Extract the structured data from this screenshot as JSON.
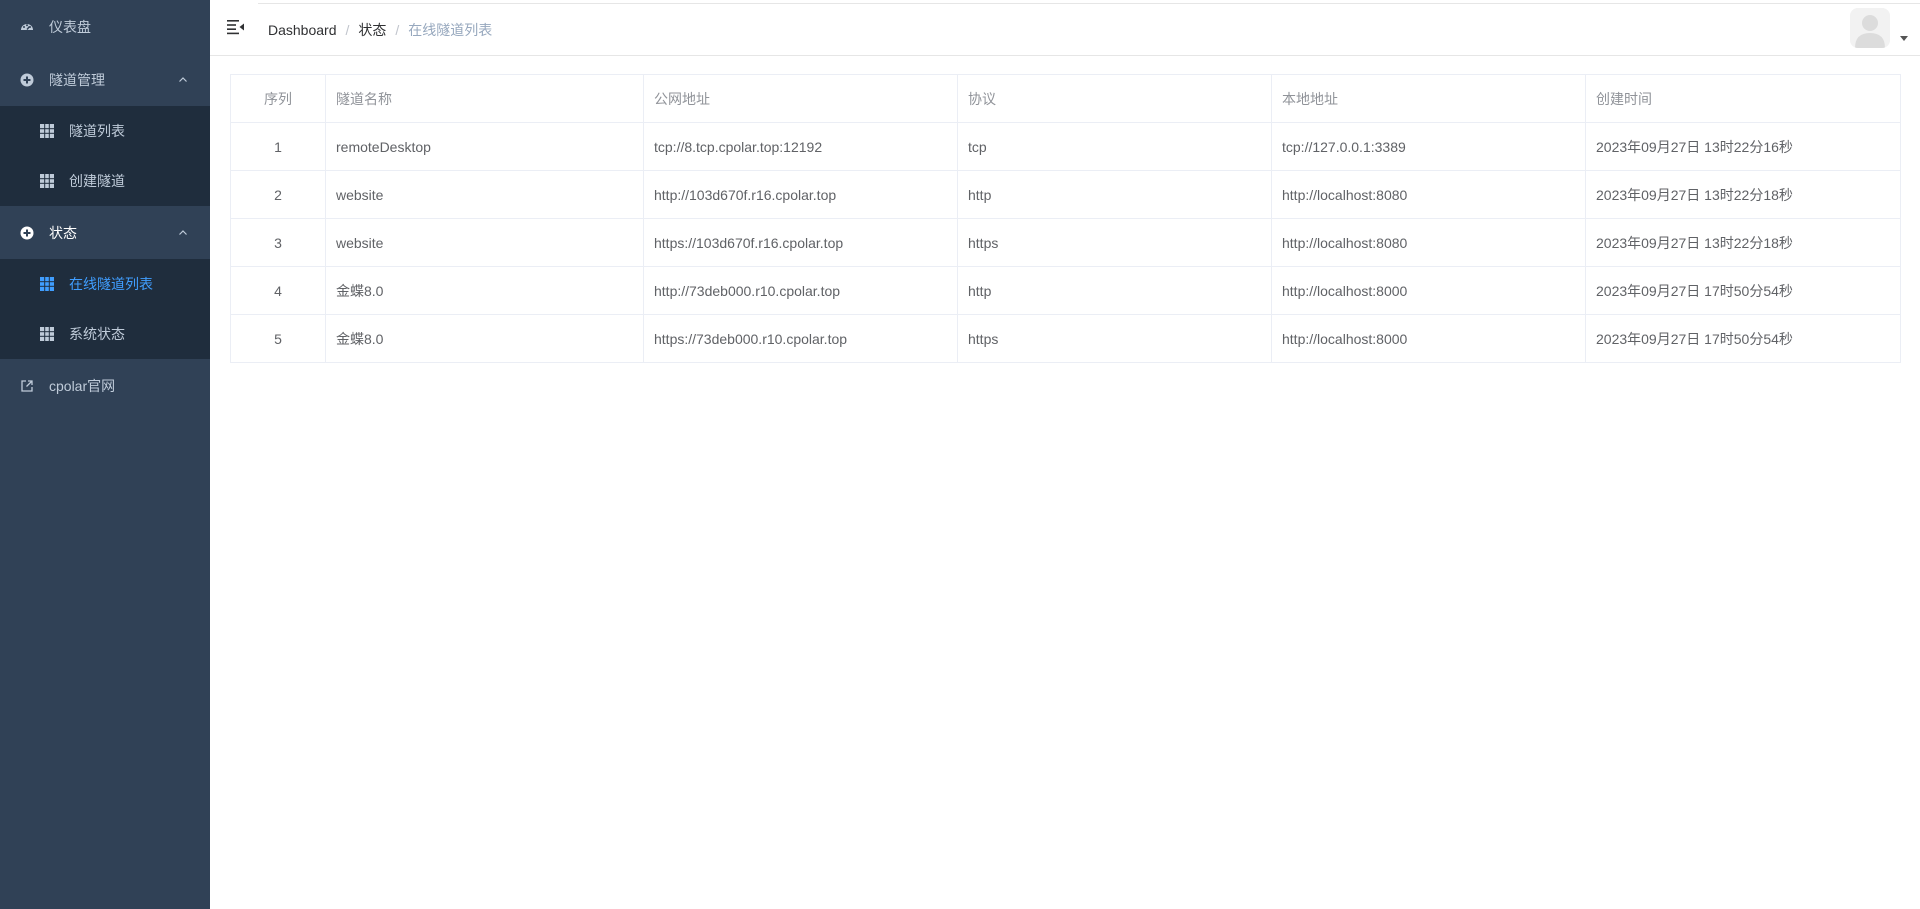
{
  "sidebar": {
    "items": [
      {
        "label": "仪表盘",
        "icon": "dashboard-icon"
      },
      {
        "label": "隧道管理",
        "icon": "plus-circle-icon",
        "expanded": true,
        "children": [
          {
            "label": "隧道列表",
            "icon": "grid-icon"
          },
          {
            "label": "创建隧道",
            "icon": "grid-icon"
          }
        ]
      },
      {
        "label": "状态",
        "icon": "plus-circle-icon",
        "expanded": true,
        "children": [
          {
            "label": "在线隧道列表",
            "icon": "grid-icon",
            "active": true
          },
          {
            "label": "系统状态",
            "icon": "grid-icon"
          }
        ]
      },
      {
        "label": "cpolar官网",
        "icon": "external-link-icon"
      }
    ]
  },
  "breadcrumb": {
    "items": [
      "Dashboard",
      "状态",
      "在线隧道列表"
    ]
  },
  "table": {
    "columns": [
      "序列",
      "隧道名称",
      "公网地址",
      "协议",
      "本地地址",
      "创建时间"
    ],
    "rows": [
      [
        "1",
        "remoteDesktop",
        "tcp://8.tcp.cpolar.top:12192",
        "tcp",
        "tcp://127.0.0.1:3389",
        "2023年09月27日 13时22分16秒"
      ],
      [
        "2",
        "website",
        "http://103d670f.r16.cpolar.top",
        "http",
        "http://localhost:8080",
        "2023年09月27日 13时22分18秒"
      ],
      [
        "3",
        "website",
        "https://103d670f.r16.cpolar.top",
        "https",
        "http://localhost:8080",
        "2023年09月27日 13时22分18秒"
      ],
      [
        "4",
        "金蝶8.0",
        "http://73deb000.r10.cpolar.top",
        "http",
        "http://localhost:8000",
        "2023年09月27日 17时50分54秒"
      ],
      [
        "5",
        "金蝶8.0",
        "https://73deb000.r10.cpolar.top",
        "https",
        "http://localhost:8000",
        "2023年09月27日 17时50分54秒"
      ]
    ]
  },
  "colors": {
    "sidebar_bg": "#304156",
    "submenu_bg": "#1f2d3d",
    "active": "#409eff",
    "menu_text": "#bfcbd9"
  }
}
